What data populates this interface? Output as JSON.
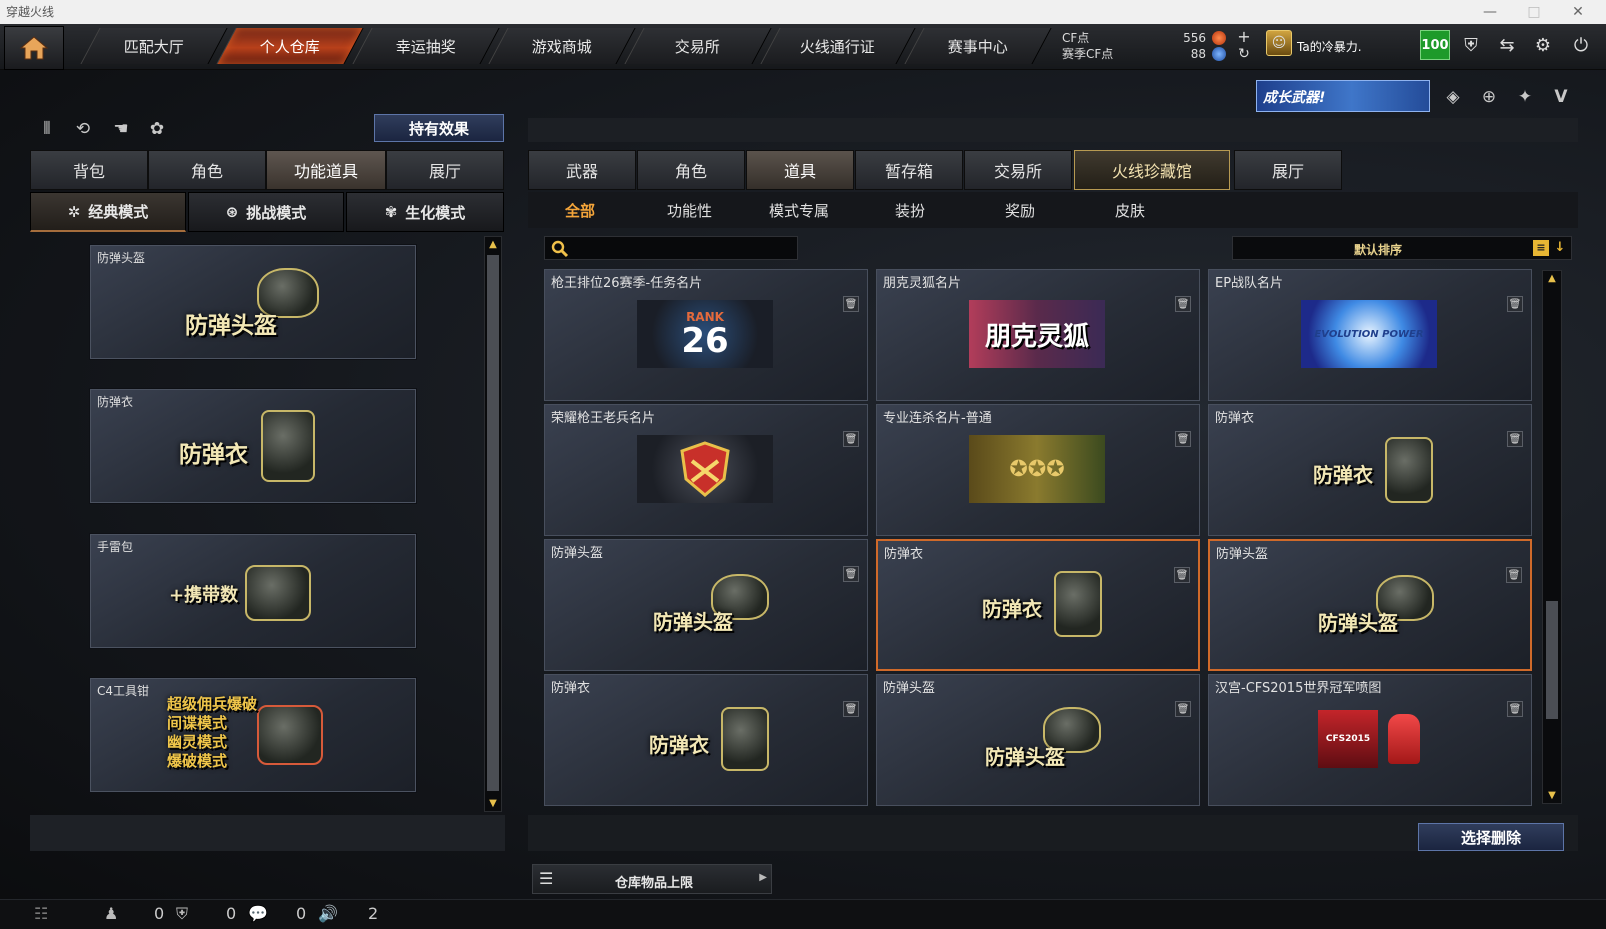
{
  "window": {
    "title": "穿越火线"
  },
  "nav": {
    "tabs": [
      "匹配大厅",
      "个人仓库",
      "幸运抽奖",
      "游戏商城",
      "交易所",
      "火线通行证",
      "赛事中心"
    ],
    "active": "个人仓库"
  },
  "currency": {
    "cf_label": "CF点",
    "cf_value": "556",
    "match_label": "赛季CF点",
    "match_value": "88"
  },
  "user": {
    "name": "Ta的冷暴力.",
    "level": "100"
  },
  "banner": {
    "text": "成长武器!"
  },
  "left": {
    "effect_button": "持有效果",
    "tabs": [
      "背包",
      "角色",
      "功能道具",
      "展厅"
    ],
    "modes": [
      "经典模式",
      "挑战模式",
      "生化模式"
    ],
    "items": [
      {
        "caption": "防弹头盔",
        "art": "防弹头盔"
      },
      {
        "caption": "防弹衣",
        "art": "防弹衣"
      },
      {
        "caption": "手雷包",
        "art": "+携带数"
      },
      {
        "caption": "C4工具钳",
        "art_lines": [
          "超级佣兵爆破",
          "间谍模式",
          "幽灵模式",
          "爆破模式"
        ]
      }
    ]
  },
  "right": {
    "tabs": [
      "武器",
      "角色",
      "道具",
      "暂存箱",
      "交易所",
      "火线珍藏馆",
      "展厅"
    ],
    "subtabs": [
      "全部",
      "功能性",
      "模式专属",
      "装扮",
      "奖励",
      "皮肤"
    ],
    "sort_label": "默认排序",
    "cards": [
      {
        "caption": "枪王排位26赛季-任务名片",
        "art": "RANK 26"
      },
      {
        "caption": "朋克灵狐名片",
        "art": "朋克灵狐"
      },
      {
        "caption": "EP战队名片",
        "art": "EVOLUTION POWER"
      },
      {
        "caption": "荣耀枪王老兵名片",
        "art": ""
      },
      {
        "caption": "专业连杀名片-普通",
        "art": ""
      },
      {
        "caption": "防弹衣",
        "art": "防弹衣"
      },
      {
        "caption": "防弹头盔",
        "art": "防弹头盔"
      },
      {
        "caption": "防弹衣",
        "art": "防弹衣"
      },
      {
        "caption": "防弹头盔",
        "art": "防弹头盔"
      },
      {
        "caption": "防弹衣",
        "art": "防弹衣"
      },
      {
        "caption": "防弹头盔",
        "art": "防弹头盔"
      },
      {
        "caption": "汉宫-CFS2015世界冠军喷图",
        "art": "CFS2015"
      }
    ],
    "delete_button": "选择删除",
    "limit_label": "仓库物品上限"
  },
  "status": {
    "c1": "0",
    "c2": "0",
    "c3": "0",
    "c4": "2"
  },
  "colors": {
    "accent": "#f4a53a",
    "active_tab": "#b8401a",
    "highlight_border": "#d06a2a"
  }
}
